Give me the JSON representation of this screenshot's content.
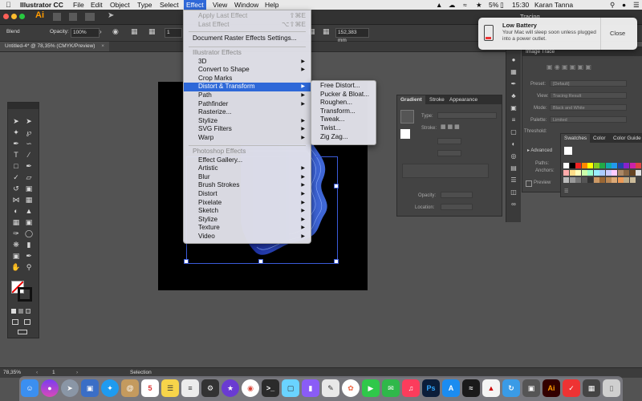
{
  "menubar": {
    "apple_icon": "apple-icon",
    "items": [
      "Illustrator CC",
      "File",
      "Edit",
      "Object",
      "Type",
      "Select",
      "Effect",
      "View",
      "Window",
      "Help"
    ],
    "active_item": "Effect",
    "status": {
      "battery_percent": "5%",
      "time": "15:30",
      "user": "Karan Tanna"
    }
  },
  "appbar": {
    "logo": "Ai",
    "workspace": "Tracing"
  },
  "controlbar": {
    "blend_label": "Blend",
    "opacity_label": "Opacity:",
    "opacity_value": "100%",
    "field_value": "1",
    "coord_value": "152,383 mm"
  },
  "document": {
    "tab_title": "Untitled-4* @ 78,35% (CMYK/Preview)"
  },
  "effect_menu": {
    "apply_last": "Apply Last Effect",
    "apply_last_shortcut": "⇧⌘E",
    "last": "Last Effect",
    "last_shortcut": "⌥⇧⌘E",
    "raster_settings": "Document Raster Effects Settings...",
    "illustrator_header": "Illustrator Effects",
    "illustrator_items": [
      "3D",
      "Convert to Shape",
      "Crop Marks",
      "Distort & Transform",
      "Path",
      "Pathfinder",
      "Rasterize...",
      "Stylize",
      "SVG Filters",
      "Warp"
    ],
    "highlighted": "Distort & Transform",
    "photoshop_header": "Photoshop Effects",
    "photoshop_items": [
      "Effect Gallery...",
      "Artistic",
      "Blur",
      "Brush Strokes",
      "Distort",
      "Pixelate",
      "Sketch",
      "Stylize",
      "Texture",
      "Video"
    ]
  },
  "submenu": {
    "items": [
      "Free Distort...",
      "Pucker & Bloat...",
      "Roughen...",
      "Transform...",
      "Tweak...",
      "Twist...",
      "Zig Zag..."
    ]
  },
  "notification": {
    "title": "Low Battery",
    "body": "Your Mac will sleep soon unless plugged into a power outlet.",
    "button": "Close"
  },
  "gradient_panel": {
    "tabs": [
      "Gradient",
      "Stroke",
      "Appearance"
    ],
    "type_label": "Type:",
    "stroke_label": "Stroke:",
    "opacity_label": "Opacity:",
    "location_label": "Location:"
  },
  "image_trace_panel": {
    "title": "Image Trace",
    "rows": [
      {
        "label": "Preset:",
        "value": "[Default]"
      },
      {
        "label": "View:",
        "value": "Tracing Result"
      },
      {
        "label": "Mode:",
        "value": "Black and White"
      },
      {
        "label": "Palette:",
        "value": "Limited"
      }
    ],
    "threshold_label": "Threshold:",
    "advanced_label": "Advanced",
    "paths_label": "Paths:",
    "anchors_label": "Anchors:",
    "preview_label": "Preview"
  },
  "swatches_panel": {
    "tabs": [
      "Swatches",
      "Color",
      "Color Guide"
    ]
  },
  "statusbar": {
    "zoom": "78,35%",
    "artboard": "1",
    "mode": "Selection"
  },
  "dock": {
    "calendar_day": "5"
  }
}
